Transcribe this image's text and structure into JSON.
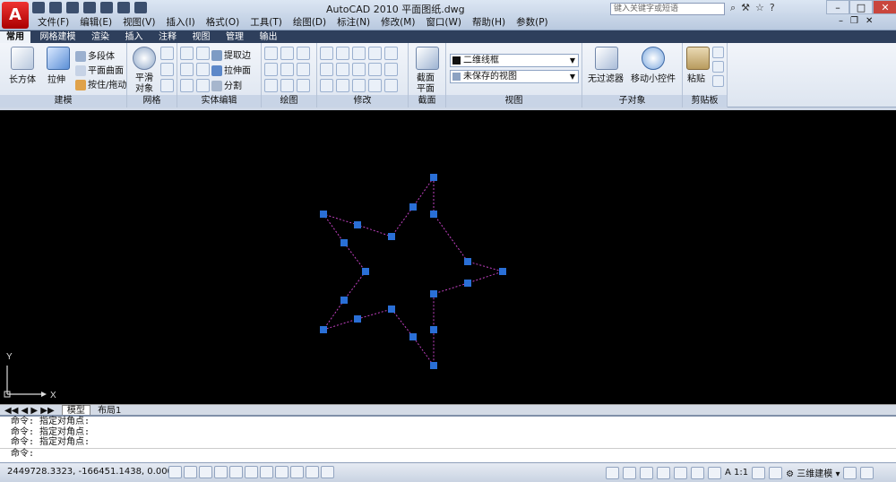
{
  "window": {
    "title": "AutoCAD 2010    平面图纸.dwg",
    "search_placeholder": "键入关键字或短语"
  },
  "menu": [
    "文件(F)",
    "编辑(E)",
    "视图(V)",
    "插入(I)",
    "格式(O)",
    "工具(T)",
    "绘图(D)",
    "标注(N)",
    "修改(M)",
    "窗口(W)",
    "帮助(H)",
    "参数(P)"
  ],
  "ribbon_tabs": [
    "常用",
    "网格建模",
    "渲染",
    "插入",
    "注释",
    "视图",
    "管理",
    "输出"
  ],
  "ribbon": {
    "modeling": {
      "box": "长方体",
      "extrude": "拉伸",
      "polysolid": "多段体",
      "planar": "平面曲面",
      "presspull": "按住/拖动",
      "label": "建模"
    },
    "mesh": {
      "smooth_l1": "平滑",
      "smooth_l2": "对象",
      "label": "网格"
    },
    "solid_edit": {
      "extract": "提取边",
      "extrude_face": "拉伸面",
      "separate": "分割",
      "label": "实体编辑"
    },
    "draw": {
      "label": "绘图"
    },
    "modify": {
      "label": "修改"
    },
    "section": {
      "plane_l1": "截面",
      "plane_l2": "平面",
      "label": "截面"
    },
    "view": {
      "visual_style": "二维线框",
      "saved_view": "未保存的视图",
      "label": "视图"
    },
    "subobject": {
      "filter": "无过滤器",
      "gizmo": "移动小控件",
      "label": "子对象"
    },
    "clipboard": {
      "paste": "粘贴",
      "label": "剪贴板"
    }
  },
  "canvas": {
    "background": "#000000",
    "star_color": "#c040c0",
    "grip_color": "#2a6fd6",
    "ucs_y": "Y",
    "ucs_x": "X"
  },
  "layout_tabs": [
    "模型",
    "布局1"
  ],
  "command_history": [
    "命令: 指定对角点:",
    "命令: 指定对角点:",
    "命令: 指定对角点:",
    "命令:"
  ],
  "status": {
    "coordinates": "2449728.3323, -166451.1438, 0.0000",
    "scale": "A 1:1",
    "workspace": "三维建模"
  }
}
